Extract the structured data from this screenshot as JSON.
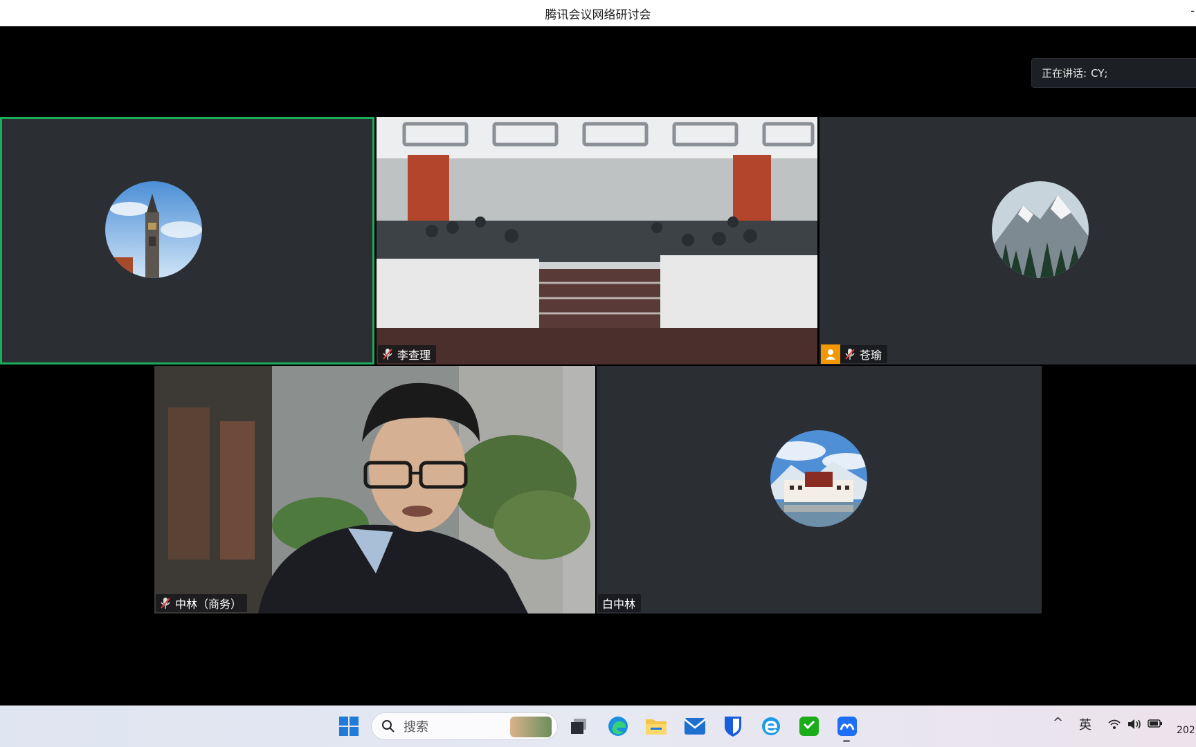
{
  "window": {
    "title": "腾讯会议网络研讨会",
    "title_right_glyph": "-"
  },
  "speaking_banner": {
    "label": "正在讲话:",
    "speaker": "CY;"
  },
  "tiles": [
    {
      "name": "",
      "type": "avatar",
      "avatar": "clock-tower-avatar",
      "active": true
    },
    {
      "name": "李查理",
      "type": "video",
      "video": "lecture-hall-video",
      "muted": true
    },
    {
      "name": "苍瑜",
      "type": "avatar",
      "avatar": "mountain-avatar",
      "muted": true,
      "host": true
    },
    {
      "name": "中林（商务）",
      "type": "video",
      "video": "speaker-man-video",
      "muted": true
    },
    {
      "name": "白中林",
      "type": "avatar",
      "avatar": "potala-palace-avatar",
      "muted": false
    }
  ],
  "taskbar": {
    "search_placeholder": "搜索",
    "apps": [
      "windows-start-icon",
      "task-view-icon",
      "edge-icon",
      "file-explorer-icon",
      "mail-icon",
      "bitwarden-icon",
      "ie-icon",
      "wechat-icon",
      "tencent-meeting-icon"
    ],
    "tray": {
      "chevron": "^",
      "ime": "英",
      "clock_partial": "202"
    }
  },
  "colors": {
    "active_border": "#1aad5a",
    "host_badge": "#f39800",
    "tile_bg": "#2b2f34"
  }
}
